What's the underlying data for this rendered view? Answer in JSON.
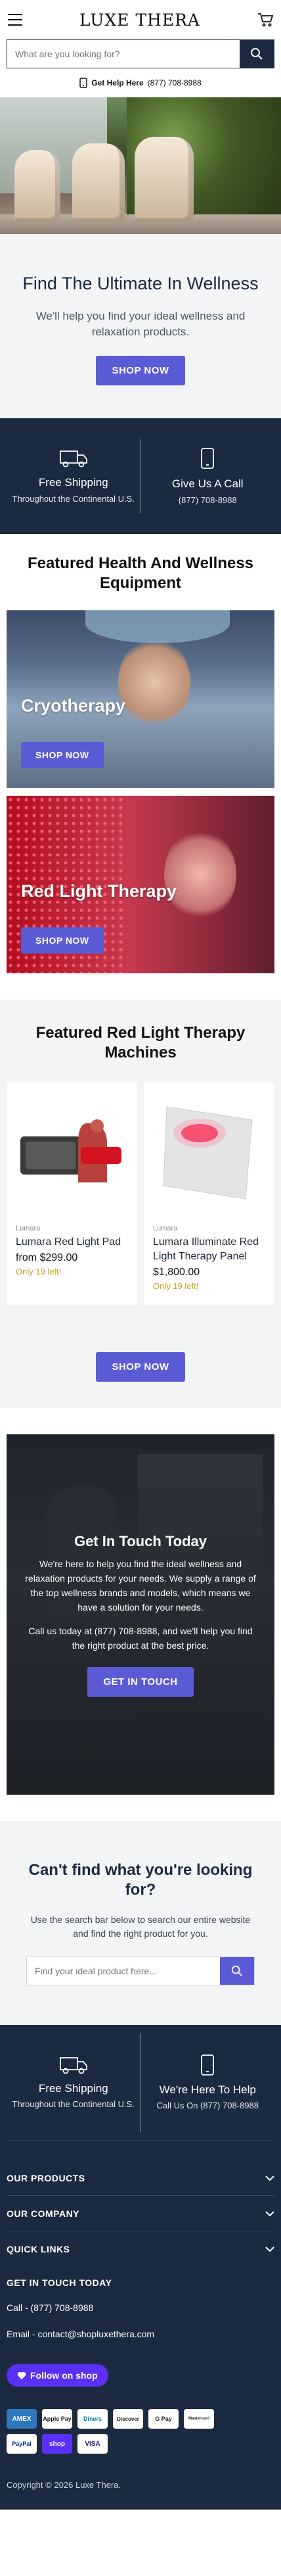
{
  "header": {
    "logo": "LUXE THERA"
  },
  "search": {
    "placeholder": "What are you looking for?"
  },
  "help": {
    "label": "Get Help Here",
    "phone": "(877) 708-8988"
  },
  "hero": {
    "title": "Find The Ultimate In Wellness",
    "subtitle": "We'll help you find your ideal wellness and relaxation products.",
    "cta": "SHOP NOW"
  },
  "info_band": [
    {
      "icon": "truck-icon",
      "title": "Free Shipping",
      "sub": "Throughout the Continental U.S."
    },
    {
      "icon": "phone-icon",
      "title": "Give Us A Call",
      "sub": "(877) 708-8988"
    }
  ],
  "equipment": {
    "title": "Featured Health And Wellness Equipment",
    "cards": [
      {
        "label": "Cryotherapy",
        "cta": "SHOP NOW"
      },
      {
        "label": "Red Light Therapy",
        "cta": "SHOP NOW"
      }
    ]
  },
  "products": {
    "title": "Featured Red Light Therapy Machines",
    "items": [
      {
        "brand": "Lumara",
        "name": "Lumara Red Light Pad",
        "price": "from $299.00",
        "stock": "Only 19 left!"
      },
      {
        "brand": "Lumara",
        "name": "Lumara Illuminate Red Light Therapy Panel",
        "price": "$1,800.00",
        "stock": "Only 19 left!"
      }
    ],
    "cta": "SHOP NOW"
  },
  "contact": {
    "title": "Get In Touch Today",
    "p1": "We're here to help you find the ideal wellness and relaxation products for your needs. We supply a range of the top wellness brands and models, which means we have a solution for your needs.",
    "p2": "Call us today at (877) 708-8988, and we'll help you find the right product at the best price.",
    "cta": "GET IN TOUCH"
  },
  "cantfind": {
    "title": "Can't find what you're looking for?",
    "text": "Use the search bar below to search our entire website and find the right product for you.",
    "placeholder": "Find your ideal product here..."
  },
  "footer": {
    "band": [
      {
        "icon": "truck-icon",
        "title": "Free Shipping",
        "sub": "Throughout the Continental U.S."
      },
      {
        "icon": "phone-icon",
        "title": "We're Here To Help",
        "sub": "Call Us On (877) 708-8988"
      }
    ],
    "accordions": [
      "OUR PRODUCTS",
      "OUR COMPANY",
      "QUICK LINKS"
    ],
    "git_title": "GET IN TOUCH TODAY",
    "call": "Call - (877) 708-8988",
    "email": "Email - contact@shopluxethera.com",
    "follow": "Follow on shop",
    "payments": [
      "AMEX",
      "Apple Pay",
      "Diners",
      "Discover",
      "G Pay",
      "Mastercard",
      "PayPal",
      "shop",
      "VISA"
    ],
    "copyright": "Copyright © 2026 Luxe Thera."
  }
}
